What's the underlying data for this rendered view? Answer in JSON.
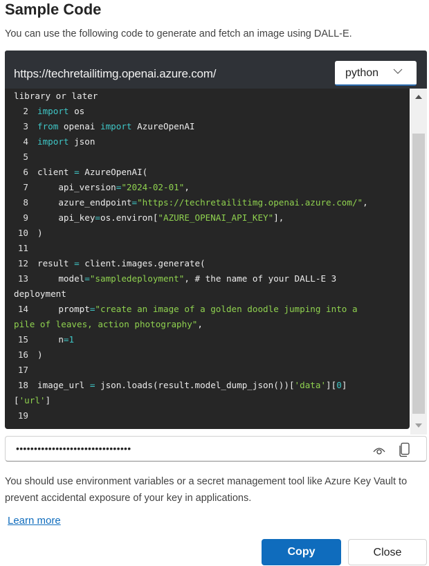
{
  "dialog": {
    "title": "Sample Code",
    "subtitle": "You can use the following code to generate and fetch an image using DALL-E."
  },
  "code_panel": {
    "endpoint": "https://techretailitimg.openai.azure.com/",
    "language": "python",
    "lines": [
      {
        "n": "",
        "tokens": [
          {
            "t": "library or later",
            "c": "plain"
          }
        ]
      },
      {
        "n": "2",
        "tokens": [
          {
            "t": "import",
            "c": "kw"
          },
          {
            "t": " os",
            "c": "plain"
          }
        ]
      },
      {
        "n": "3",
        "tokens": [
          {
            "t": "from",
            "c": "kw"
          },
          {
            "t": " openai ",
            "c": "plain"
          },
          {
            "t": "import",
            "c": "kw"
          },
          {
            "t": " AzureOpenAI",
            "c": "plain"
          }
        ]
      },
      {
        "n": "4",
        "tokens": [
          {
            "t": "import",
            "c": "kw"
          },
          {
            "t": " json",
            "c": "plain"
          }
        ]
      },
      {
        "n": "5",
        "tokens": []
      },
      {
        "n": "6",
        "tokens": [
          {
            "t": "client ",
            "c": "plain"
          },
          {
            "t": "=",
            "c": "op"
          },
          {
            "t": " AzureOpenAI(",
            "c": "plain"
          }
        ]
      },
      {
        "n": "7",
        "tokens": [
          {
            "t": "    api_version",
            "c": "plain"
          },
          {
            "t": "=",
            "c": "op"
          },
          {
            "t": "\"2024-02-01\"",
            "c": "str"
          },
          {
            "t": ",",
            "c": "plain"
          }
        ]
      },
      {
        "n": "8",
        "tokens": [
          {
            "t": "    azure_endpoint",
            "c": "plain"
          },
          {
            "t": "=",
            "c": "op"
          },
          {
            "t": "\"https://techretailitimg.openai.azure.com/\"",
            "c": "str"
          },
          {
            "t": ",",
            "c": "plain"
          }
        ]
      },
      {
        "n": "9",
        "tokens": [
          {
            "t": "    api_key",
            "c": "plain"
          },
          {
            "t": "=",
            "c": "op"
          },
          {
            "t": "os.environ[",
            "c": "plain"
          },
          {
            "t": "\"AZURE_OPENAI_API_KEY\"",
            "c": "str"
          },
          {
            "t": "],",
            "c": "plain"
          }
        ]
      },
      {
        "n": "10",
        "tokens": [
          {
            "t": ")",
            "c": "plain"
          }
        ]
      },
      {
        "n": "11",
        "tokens": []
      },
      {
        "n": "12",
        "tokens": [
          {
            "t": "result ",
            "c": "plain"
          },
          {
            "t": "=",
            "c": "op"
          },
          {
            "t": " client.images.generate(",
            "c": "plain"
          }
        ]
      },
      {
        "n": "13",
        "tokens": [
          {
            "t": "    model",
            "c": "plain"
          },
          {
            "t": "=",
            "c": "op"
          },
          {
            "t": "\"sampledeployment\"",
            "c": "str"
          },
          {
            "t": ", # the name of your DALL-E 3",
            "c": "plain"
          }
        ]
      },
      {
        "n": "",
        "tokens": [
          {
            "t": "deployment",
            "c": "plain"
          }
        ]
      },
      {
        "n": "14",
        "tokens": [
          {
            "t": "    prompt",
            "c": "plain"
          },
          {
            "t": "=",
            "c": "op"
          },
          {
            "t": "\"create an image of a golden doodle jumping into a",
            "c": "str"
          }
        ]
      },
      {
        "n": "",
        "tokens": [
          {
            "t": "pile of leaves, action photography\"",
            "c": "str"
          },
          {
            "t": ",",
            "c": "plain"
          }
        ]
      },
      {
        "n": "15",
        "tokens": [
          {
            "t": "    n",
            "c": "plain"
          },
          {
            "t": "=",
            "c": "op"
          },
          {
            "t": "1",
            "c": "num"
          }
        ]
      },
      {
        "n": "16",
        "tokens": [
          {
            "t": ")",
            "c": "plain"
          }
        ]
      },
      {
        "n": "17",
        "tokens": []
      },
      {
        "n": "18",
        "tokens": [
          {
            "t": "image_url ",
            "c": "plain"
          },
          {
            "t": "=",
            "c": "op"
          },
          {
            "t": " json.loads(result.model_dump_json())[",
            "c": "plain"
          },
          {
            "t": "'data'",
            "c": "str"
          },
          {
            "t": "][",
            "c": "plain"
          },
          {
            "t": "0",
            "c": "num"
          },
          {
            "t": "]",
            "c": "plain"
          }
        ]
      },
      {
        "n": "",
        "tokens": [
          {
            "t": "[",
            "c": "plain"
          },
          {
            "t": "'url'",
            "c": "str"
          },
          {
            "t": "]",
            "c": "plain"
          }
        ]
      },
      {
        "n": "19",
        "tokens": []
      }
    ]
  },
  "key_field": {
    "masked_value": "••••••••••••••••••••••••••••••••"
  },
  "note": "You should use environment variables or a secret management tool like Azure Key Vault to prevent accidental exposure of your key in applications.",
  "learn_more": "Learn more",
  "buttons": {
    "copy": "Copy",
    "close": "Close"
  },
  "colors": {
    "primary": "#0f6cbd",
    "code_bg": "#262626",
    "keyword": "#3fc7c7",
    "string": "#8fd14f"
  }
}
